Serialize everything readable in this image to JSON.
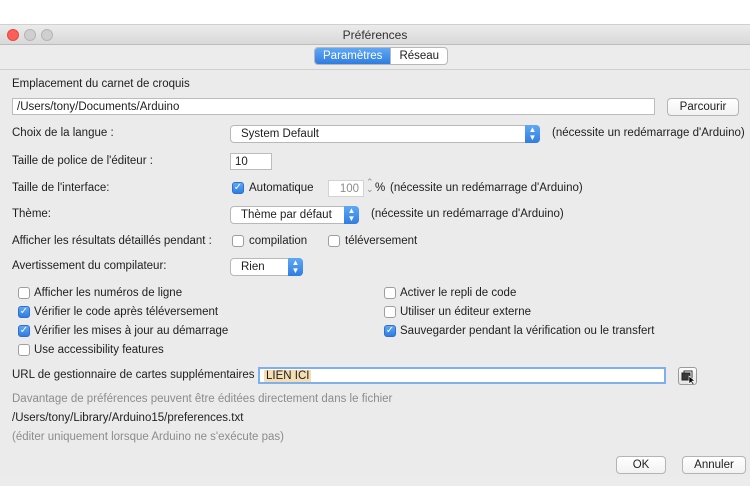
{
  "window": {
    "title": "Préférences"
  },
  "tabs": [
    {
      "label": "Paramètres",
      "active": true
    },
    {
      "label": "Réseau",
      "active": false
    }
  ],
  "sketchbook": {
    "label": "Emplacement du carnet de croquis",
    "path": "/Users/tony/Documents/Arduino",
    "browse_label": "Parcourir"
  },
  "language": {
    "label": "Choix de la langue :",
    "value": "System Default",
    "note": "(nécessite un redémarrage d'Arduino)"
  },
  "font_size": {
    "label": "Taille de police de l'éditeur :",
    "value": "10"
  },
  "interface_size": {
    "label": "Taille de l'interface:",
    "auto_label": "Automatique",
    "auto_checked": true,
    "value": "100",
    "unit": "%",
    "note": "(nécessite un redémarrage d'Arduino)"
  },
  "theme": {
    "label": "Thème:",
    "value": "Thème par défaut",
    "note": "(nécessite un redémarrage d'Arduino)"
  },
  "verbose": {
    "label": "Afficher les résultats détaillés pendant :",
    "compile_label": "compilation",
    "compile_checked": false,
    "upload_label": "téléversement",
    "upload_checked": false
  },
  "warnings": {
    "label": "Avertissement du compilateur:",
    "value": "Rien"
  },
  "options_left": [
    {
      "label": "Afficher les numéros de ligne",
      "checked": false
    },
    {
      "label": "Vérifier le code après téléversement",
      "checked": true
    },
    {
      "label": "Vérifier les mises à jour au démarrage",
      "checked": true
    },
    {
      "label": "Use accessibility features",
      "checked": false
    }
  ],
  "options_right": [
    {
      "label": "Activer le repli de code",
      "checked": false
    },
    {
      "label": "Utiliser un éditeur externe",
      "checked": false
    },
    {
      "label": "Sauvegarder pendant la vérification ou le transfert",
      "checked": true
    }
  ],
  "boards_url": {
    "label": "URL de gestionnaire de cartes supplémentaires",
    "value": "LIEN ICI"
  },
  "info": {
    "line1": "Davantage de préférences peuvent être éditées directement dans le fichier",
    "path": "/Users/tony/Library/Arduino15/preferences.txt",
    "line3": "(éditer uniquement lorsque Arduino ne s'exécute pas)"
  },
  "footer": {
    "ok_label": "OK",
    "cancel_label": "Annuler"
  },
  "colors": {
    "accent": "#2f7de1",
    "url_highlight": "#f5deb3"
  }
}
